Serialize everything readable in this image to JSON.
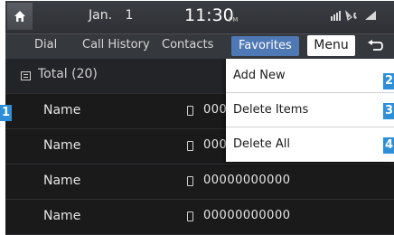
{
  "status": {
    "date": "Jan. 1",
    "time": "11:30",
    "ampm": "PM"
  },
  "tabs": [
    {
      "label": "Dial"
    },
    {
      "label": "Call History"
    },
    {
      "label": "Contacts"
    },
    {
      "label": "Favorites",
      "active": true
    }
  ],
  "menu_button": "Menu",
  "total_label": "Total (20)",
  "contacts": [
    {
      "name": "Name",
      "number": "00000000000"
    },
    {
      "name": "Name",
      "number": "00000000000"
    },
    {
      "name": "Name",
      "number": "00000000000"
    },
    {
      "name": "Name",
      "number": "00000000000"
    }
  ],
  "menu_items": [
    {
      "label": "Add New",
      "callout": "2"
    },
    {
      "label": "Delete Items",
      "callout": "3"
    },
    {
      "label": "Delete All",
      "callout": "4"
    }
  ],
  "callout_main": "1",
  "colors": {
    "active_tab": "#4f79b5",
    "callout": "#2e8fd8"
  }
}
